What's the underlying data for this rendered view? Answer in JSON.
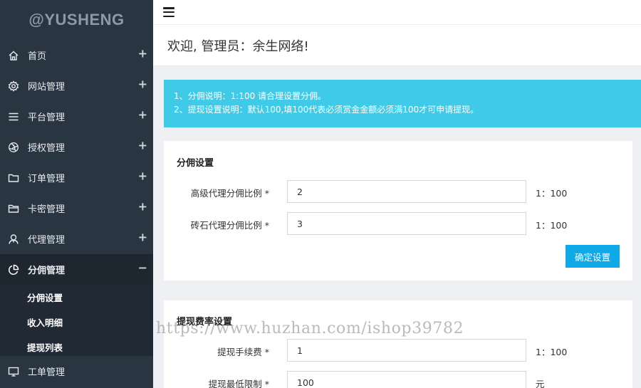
{
  "sidebar": {
    "logo": "@YUSHENG",
    "items": [
      {
        "label": "首页",
        "icon": "home-icon",
        "toggle": "+"
      },
      {
        "label": "网站管理",
        "icon": "gear-icon",
        "toggle": "+"
      },
      {
        "label": "平台管理",
        "icon": "list-icon",
        "toggle": "+"
      },
      {
        "label": "授权管理",
        "icon": "aperture-icon",
        "toggle": "+"
      },
      {
        "label": "订单管理",
        "icon": "folder-icon",
        "toggle": "+"
      },
      {
        "label": "卡密管理",
        "icon": "folder-outline-icon",
        "toggle": "+"
      },
      {
        "label": "代理管理",
        "icon": "user-icon",
        "toggle": "+"
      },
      {
        "label": "分佣管理",
        "icon": "pie-chart-icon",
        "toggle": "−"
      }
    ],
    "subitems": [
      {
        "label": "分佣设置"
      },
      {
        "label": "收入明细"
      },
      {
        "label": "提现列表"
      }
    ],
    "after": {
      "label": "工单管理",
      "icon": "monitor-icon"
    }
  },
  "header": {
    "welcome": "欢迎, 管理员：余生网络!"
  },
  "alert": {
    "line1": "1、分佣说明：1:100 请合理设置分佣。",
    "line2": "2、提现设置说明：默认100,填100代表必须赏金金额必须满100才可申请提现。"
  },
  "commission": {
    "title": "分佣设置",
    "rows": [
      {
        "label": "高级代理分佣比例 *",
        "value": "2",
        "suffix": "1：100"
      },
      {
        "label": "砖石代理分佣比例 *",
        "value": "3",
        "suffix": "1：100"
      }
    ],
    "button": "确定设置"
  },
  "withdraw": {
    "title": "提现费率设置",
    "rows": [
      {
        "label": "提现手续费 *",
        "value": "1",
        "suffix": "1：100"
      },
      {
        "label": "提现最低限制 *",
        "value": "100",
        "suffix": "元"
      }
    ]
  },
  "watermark": "https://www.huzhan.com/ishop39782"
}
